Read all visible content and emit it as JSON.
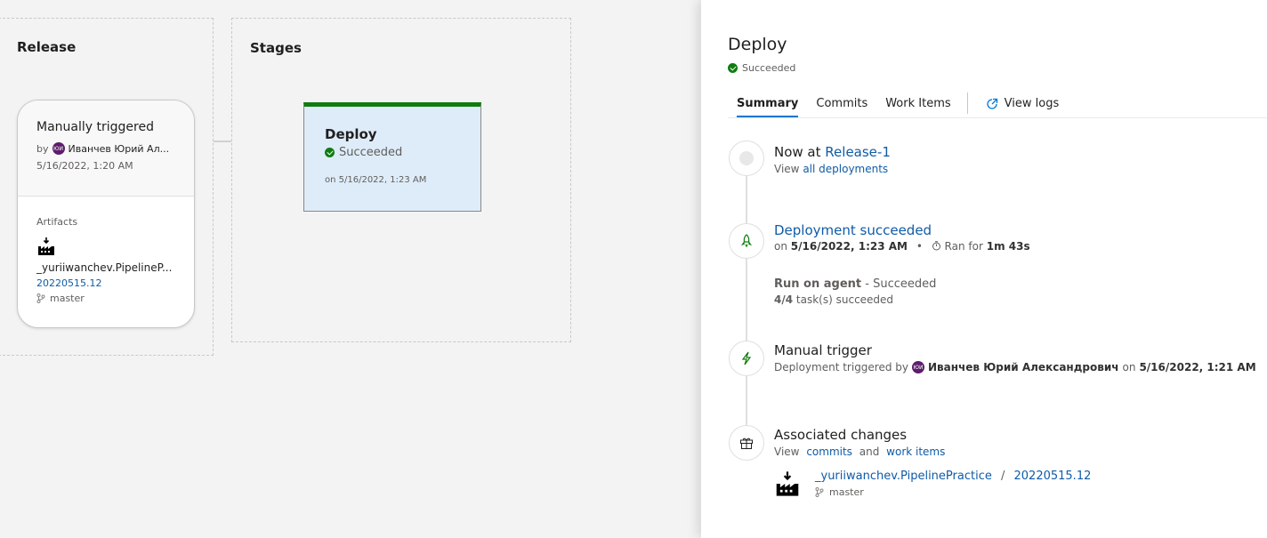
{
  "canvas": {
    "release_title": "Release",
    "stages_title": "Stages",
    "release_card": {
      "trigger": "Manually triggered",
      "by_label": "by",
      "avatar_initials": "ЮИ",
      "user": "Иванчев Юрий Ал...",
      "date": "5/16/2022, 1:20 AM",
      "artifacts_label": "Artifacts",
      "artifact_name": "_yuriiwanchev.PipelineP...",
      "artifact_version": "20220515.12",
      "branch": "master"
    },
    "stage_card": {
      "name": "Deploy",
      "status": "Succeeded",
      "when": "on 5/16/2022, 1:23 AM",
      "accent": "#107c10"
    }
  },
  "panel": {
    "title": "Deploy",
    "status": "Succeeded",
    "tabs": [
      {
        "label": "Summary",
        "active": true
      },
      {
        "label": "Commits",
        "active": false
      },
      {
        "label": "Work Items",
        "active": false
      }
    ],
    "view_logs": "View logs",
    "timeline": {
      "now_at_prefix": "Now at",
      "release_link": "Release-1",
      "view_prefix": "View",
      "all_deployments": "all deployments",
      "deploy_heading": "Deployment succeeded",
      "deploy_on": "on",
      "deploy_date": "5/16/2022, 1:23 AM",
      "bullet": "•",
      "ran_for_label": "Ran for",
      "ran_for_value": "1m 43s",
      "agent_label": "Run on agent",
      "agent_status": "- Succeeded",
      "tasks_count": "4/4",
      "tasks_text": "task(s) succeeded",
      "manual_heading": "Manual trigger",
      "manual_prefix": "Deployment triggered by",
      "manual_avatar": "ЮИ",
      "manual_user": "Иванчев Юрий Александрович",
      "manual_on": "on",
      "manual_date": "5/16/2022, 1:21 AM",
      "changes_heading": "Associated changes",
      "changes_view": "View",
      "commits_link": "commits",
      "and": "and",
      "work_items_link": "work items",
      "artifact_link": "_yuriiwanchev.PipelinePractice",
      "slash": "/",
      "version_link": "20220515.12",
      "branch": "master"
    }
  },
  "colors": {
    "success": "#107c10",
    "link": "#0f5ba7",
    "accent": "#0078d4",
    "stage_bg": "#deecf9"
  }
}
